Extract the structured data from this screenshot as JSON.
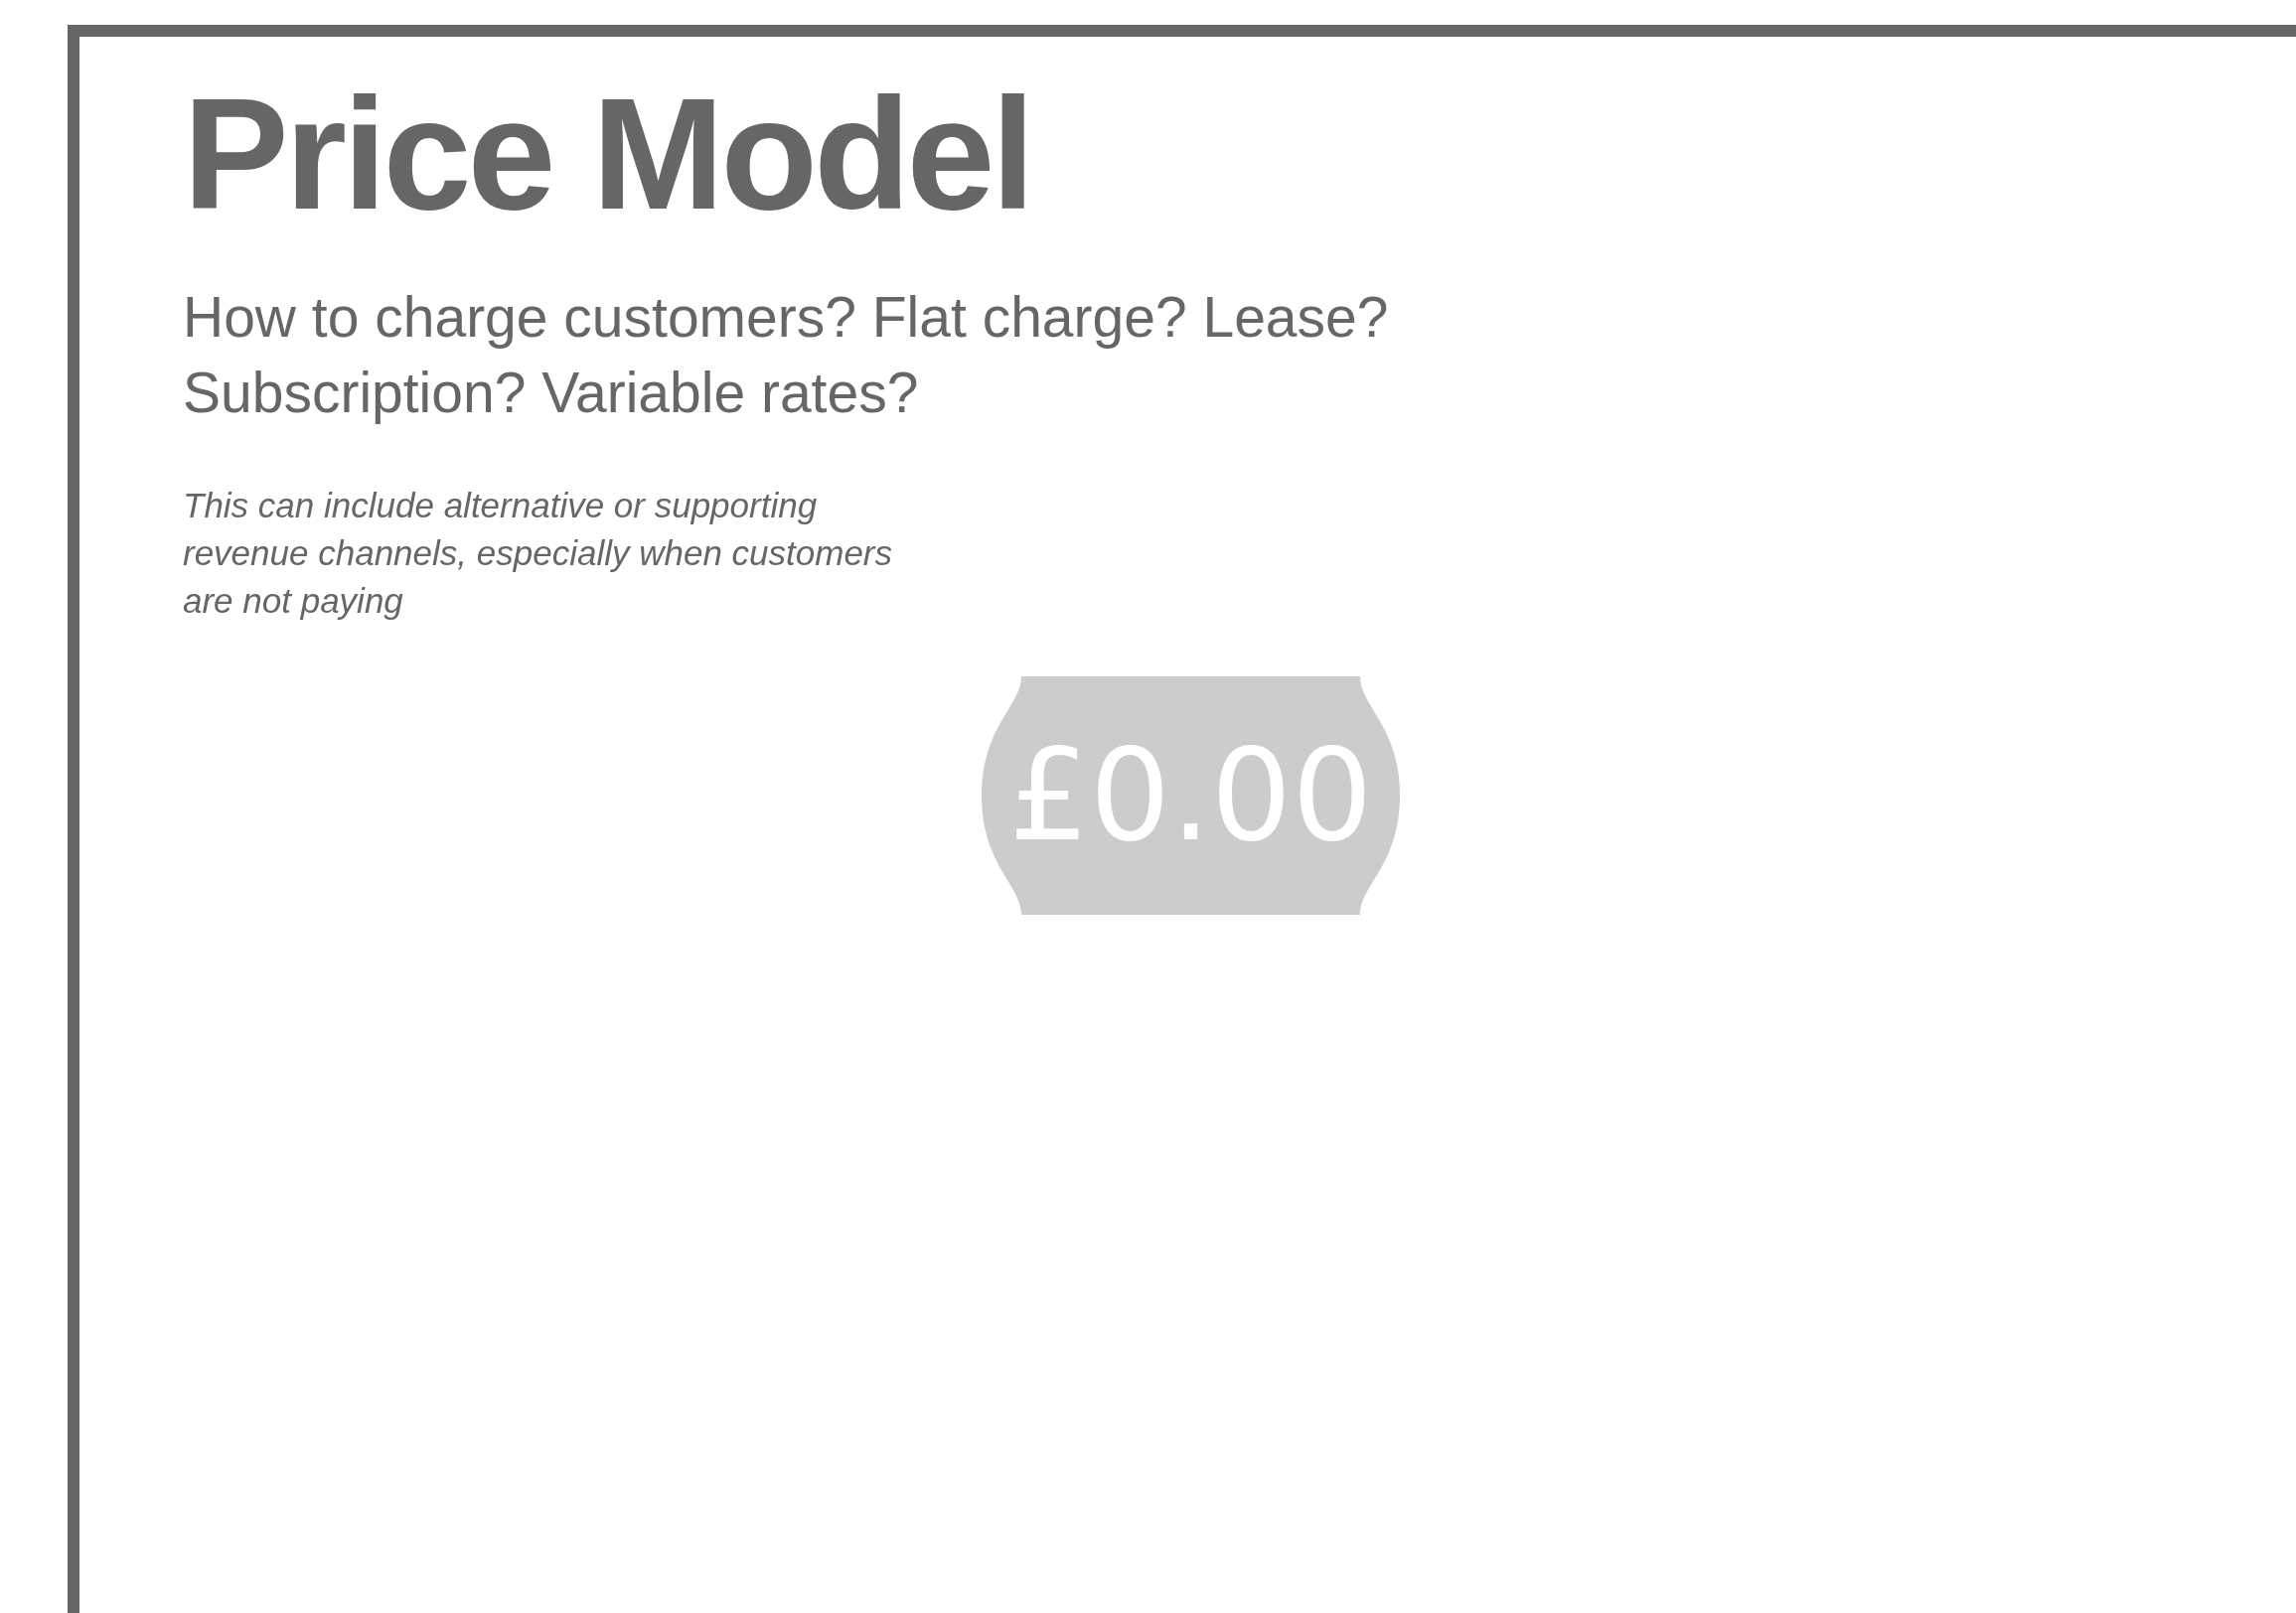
{
  "title": "Price Model",
  "question": "How to charge customers? Flat charge? Lease? Subscription? Variable rates?",
  "note": "This can include alternative or supporting revenue channels, especially when customers are not paying",
  "price_tag": {
    "price": "£0.00"
  }
}
